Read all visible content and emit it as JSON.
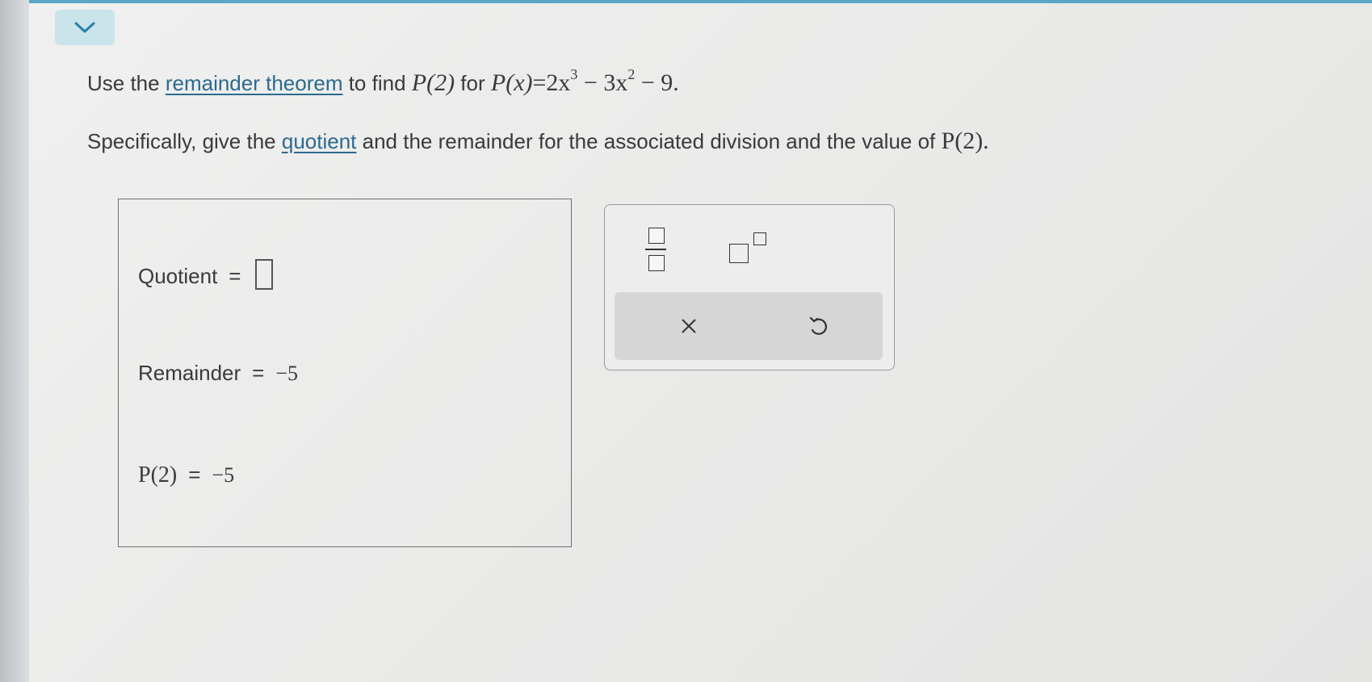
{
  "question": {
    "line1": {
      "pre": "Use the ",
      "link": "remainder theorem",
      "mid": " to find ",
      "target": "P(2)",
      "for_text": " for ",
      "poly_lhs": "P(x)",
      "poly_rhs_parts": [
        "=2x",
        "3",
        " − 3x",
        "2",
        " − 9."
      ]
    },
    "line2": {
      "pre": "Specifically, give the ",
      "link": "quotient",
      "post": " and the remainder for the associated division and the value of ",
      "target": "P(2)."
    }
  },
  "answer": {
    "quotient_label": "Quotient",
    "remainder_label": "Remainder",
    "remainder_value": "−5",
    "p2_label": "P(2)",
    "p2_value": "−5",
    "equals": "="
  },
  "keypad": {
    "fraction_icon": "fraction-icon",
    "exponent_icon": "exponent-icon",
    "clear_icon": "clear-x-icon",
    "undo_icon": "undo-icon"
  },
  "colors": {
    "link": "#2b6a8f",
    "accent_bar": "#5aa6c8",
    "collapse_button": "#c9e4ea",
    "action_bar": "#d6d6d6"
  }
}
